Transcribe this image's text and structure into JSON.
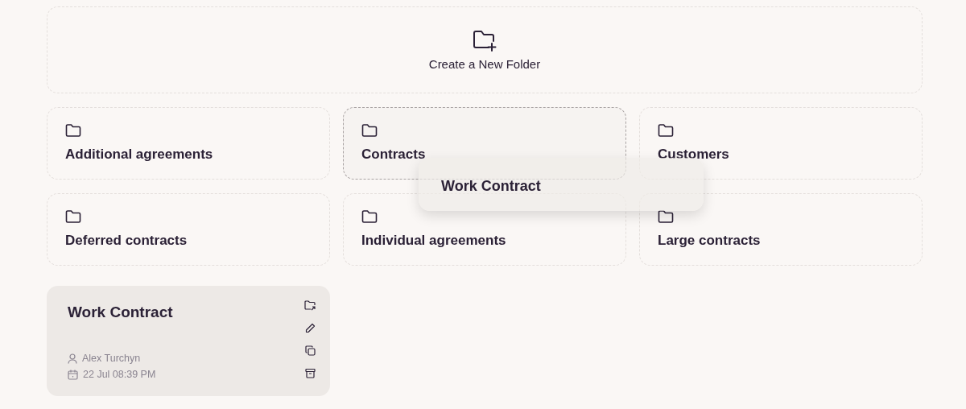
{
  "create_folder": {
    "label": "Create a New Folder"
  },
  "folders": [
    {
      "name": "Additional agreements",
      "drop_target": false
    },
    {
      "name": "Contracts",
      "drop_target": true
    },
    {
      "name": "Customers",
      "drop_target": false
    },
    {
      "name": "Deferred contracts",
      "drop_target": false
    },
    {
      "name": "Individual agreements",
      "drop_target": false
    },
    {
      "name": "Large contracts",
      "drop_target": false
    }
  ],
  "drag_preview": {
    "title": "Work Contract"
  },
  "document": {
    "title": "Work Contract",
    "author": "Alex Turchyn",
    "date": "22 Jul 08:39 PM"
  }
}
